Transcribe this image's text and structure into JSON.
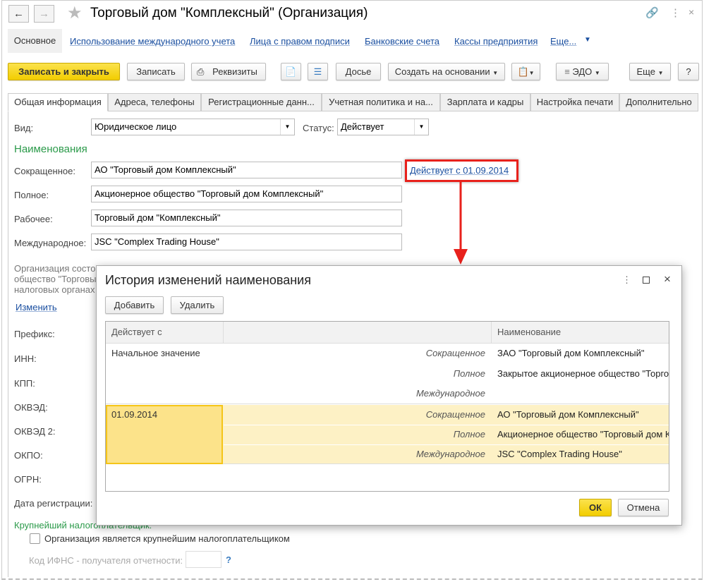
{
  "window": {
    "title": "Торговый дом \"Комплексный\" (Организация)"
  },
  "nav_links": [
    "Основное",
    "Использование международного учета",
    "Лица с правом подписи",
    "Банковские счета",
    "Кассы предприятия",
    "Еще..."
  ],
  "toolbar": {
    "save_close": "Записать и закрыть",
    "save": "Записать",
    "requisites": "Реквизиты",
    "dossier": "Досье",
    "create_based": "Создать на основании",
    "edo": "ЭДО",
    "more": "Еще",
    "help": "?"
  },
  "tabs": [
    "Общая информация",
    "Адреса, телефоны",
    "Регистрационные данн...",
    "Учетная политика и на...",
    "Зарплата и кадры",
    "Настройка печати",
    "Дополнительно"
  ],
  "form": {
    "kind_label": "Вид:",
    "kind_value": "Юридическое лицо",
    "status_label": "Статус:",
    "status_value": "Действует",
    "names_header": "Наименования",
    "short_label": "Сокращенное:",
    "short_value": "АО \"Торговый дом Комплексный\"",
    "valid_link": "Действует с 01.09.2014",
    "full_label": "Полное:",
    "full_value": "Акционерное общество \"Торговый дом Комплексный\"",
    "work_label": "Рабочее:",
    "work_value": "Торговый дом \"Комплексный\"",
    "intl_label": "Международное:",
    "intl_value": "JSC \"Complex Trading House\"",
    "info_lines": [
      "Организация состо",
      "общество \"Торговы",
      "налоговых органах"
    ],
    "change_link": "Изменить",
    "fields": [
      "Префикс:",
      "ИНН:",
      "КПП:",
      "ОКВЭД:",
      "ОКВЭД 2:",
      "ОКПО:",
      "ОГРН:",
      "Дата регистрации:"
    ],
    "largest_header": "Крупнейший налогоплательщик:",
    "largest_checkbox": "Организация является крупнейшим налогоплательщиком",
    "ifns_label": "Код ИФНС - получателя отчетности:",
    "ifns_help": "?"
  },
  "dialog": {
    "title": "История изменений наименования",
    "add": "Добавить",
    "delete": "Удалить",
    "columns": [
      "Действует с",
      "",
      "Наименование"
    ],
    "rows": [
      {
        "date": "Начальное значение",
        "items": [
          {
            "kind": "Сокращенное",
            "name": "ЗАО \"Торговый дом Комплексный\""
          },
          {
            "kind": "Полное",
            "name": "Закрытое акционерное общество \"Торгов"
          },
          {
            "kind": "Международное",
            "name": ""
          }
        ]
      },
      {
        "date": "01.09.2014",
        "selected": true,
        "items": [
          {
            "kind": "Сокращенное",
            "name": "АО \"Торговый дом Комплексный\""
          },
          {
            "kind": "Полное",
            "name": "Акционерное общество \"Торговый дом К"
          },
          {
            "kind": "Международное",
            "name": "JSC \"Complex Trading House\""
          }
        ]
      }
    ],
    "ok": "ОК",
    "cancel": "Отмена"
  },
  "colors": {
    "accent_yellow": "#f2cd00",
    "link": "#1a4fa0",
    "green": "#2b9a4a",
    "highlight": "#e8211c",
    "selected_row": "#fdf1c5",
    "selected_cell": "#fce38a"
  }
}
